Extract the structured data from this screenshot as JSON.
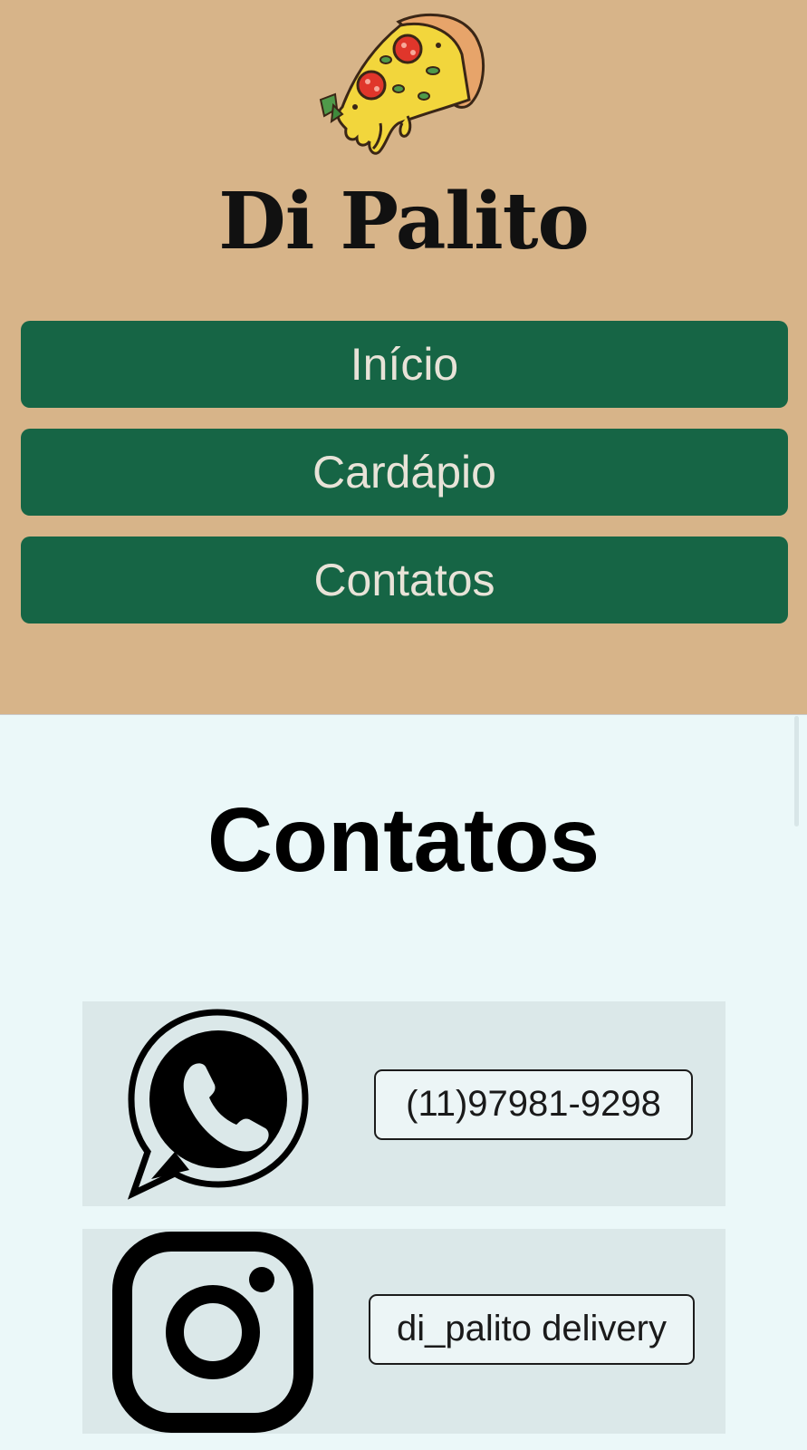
{
  "header": {
    "brand": "Di Palito",
    "logo_icon": "pizza-slice-icon",
    "background_color": "#d7b489"
  },
  "nav": {
    "items": [
      {
        "label": "Início"
      },
      {
        "label": "Cardápio"
      },
      {
        "label": "Contatos"
      }
    ],
    "button_color": "#166545",
    "text_color": "#e8e3d8"
  },
  "main": {
    "title": "Contatos",
    "background_color": "#ebf8f9",
    "contacts": [
      {
        "icon": "whatsapp-icon",
        "label": "(11)97981-9298"
      },
      {
        "icon": "instagram-icon",
        "label": "di_palito delivery"
      }
    ]
  }
}
